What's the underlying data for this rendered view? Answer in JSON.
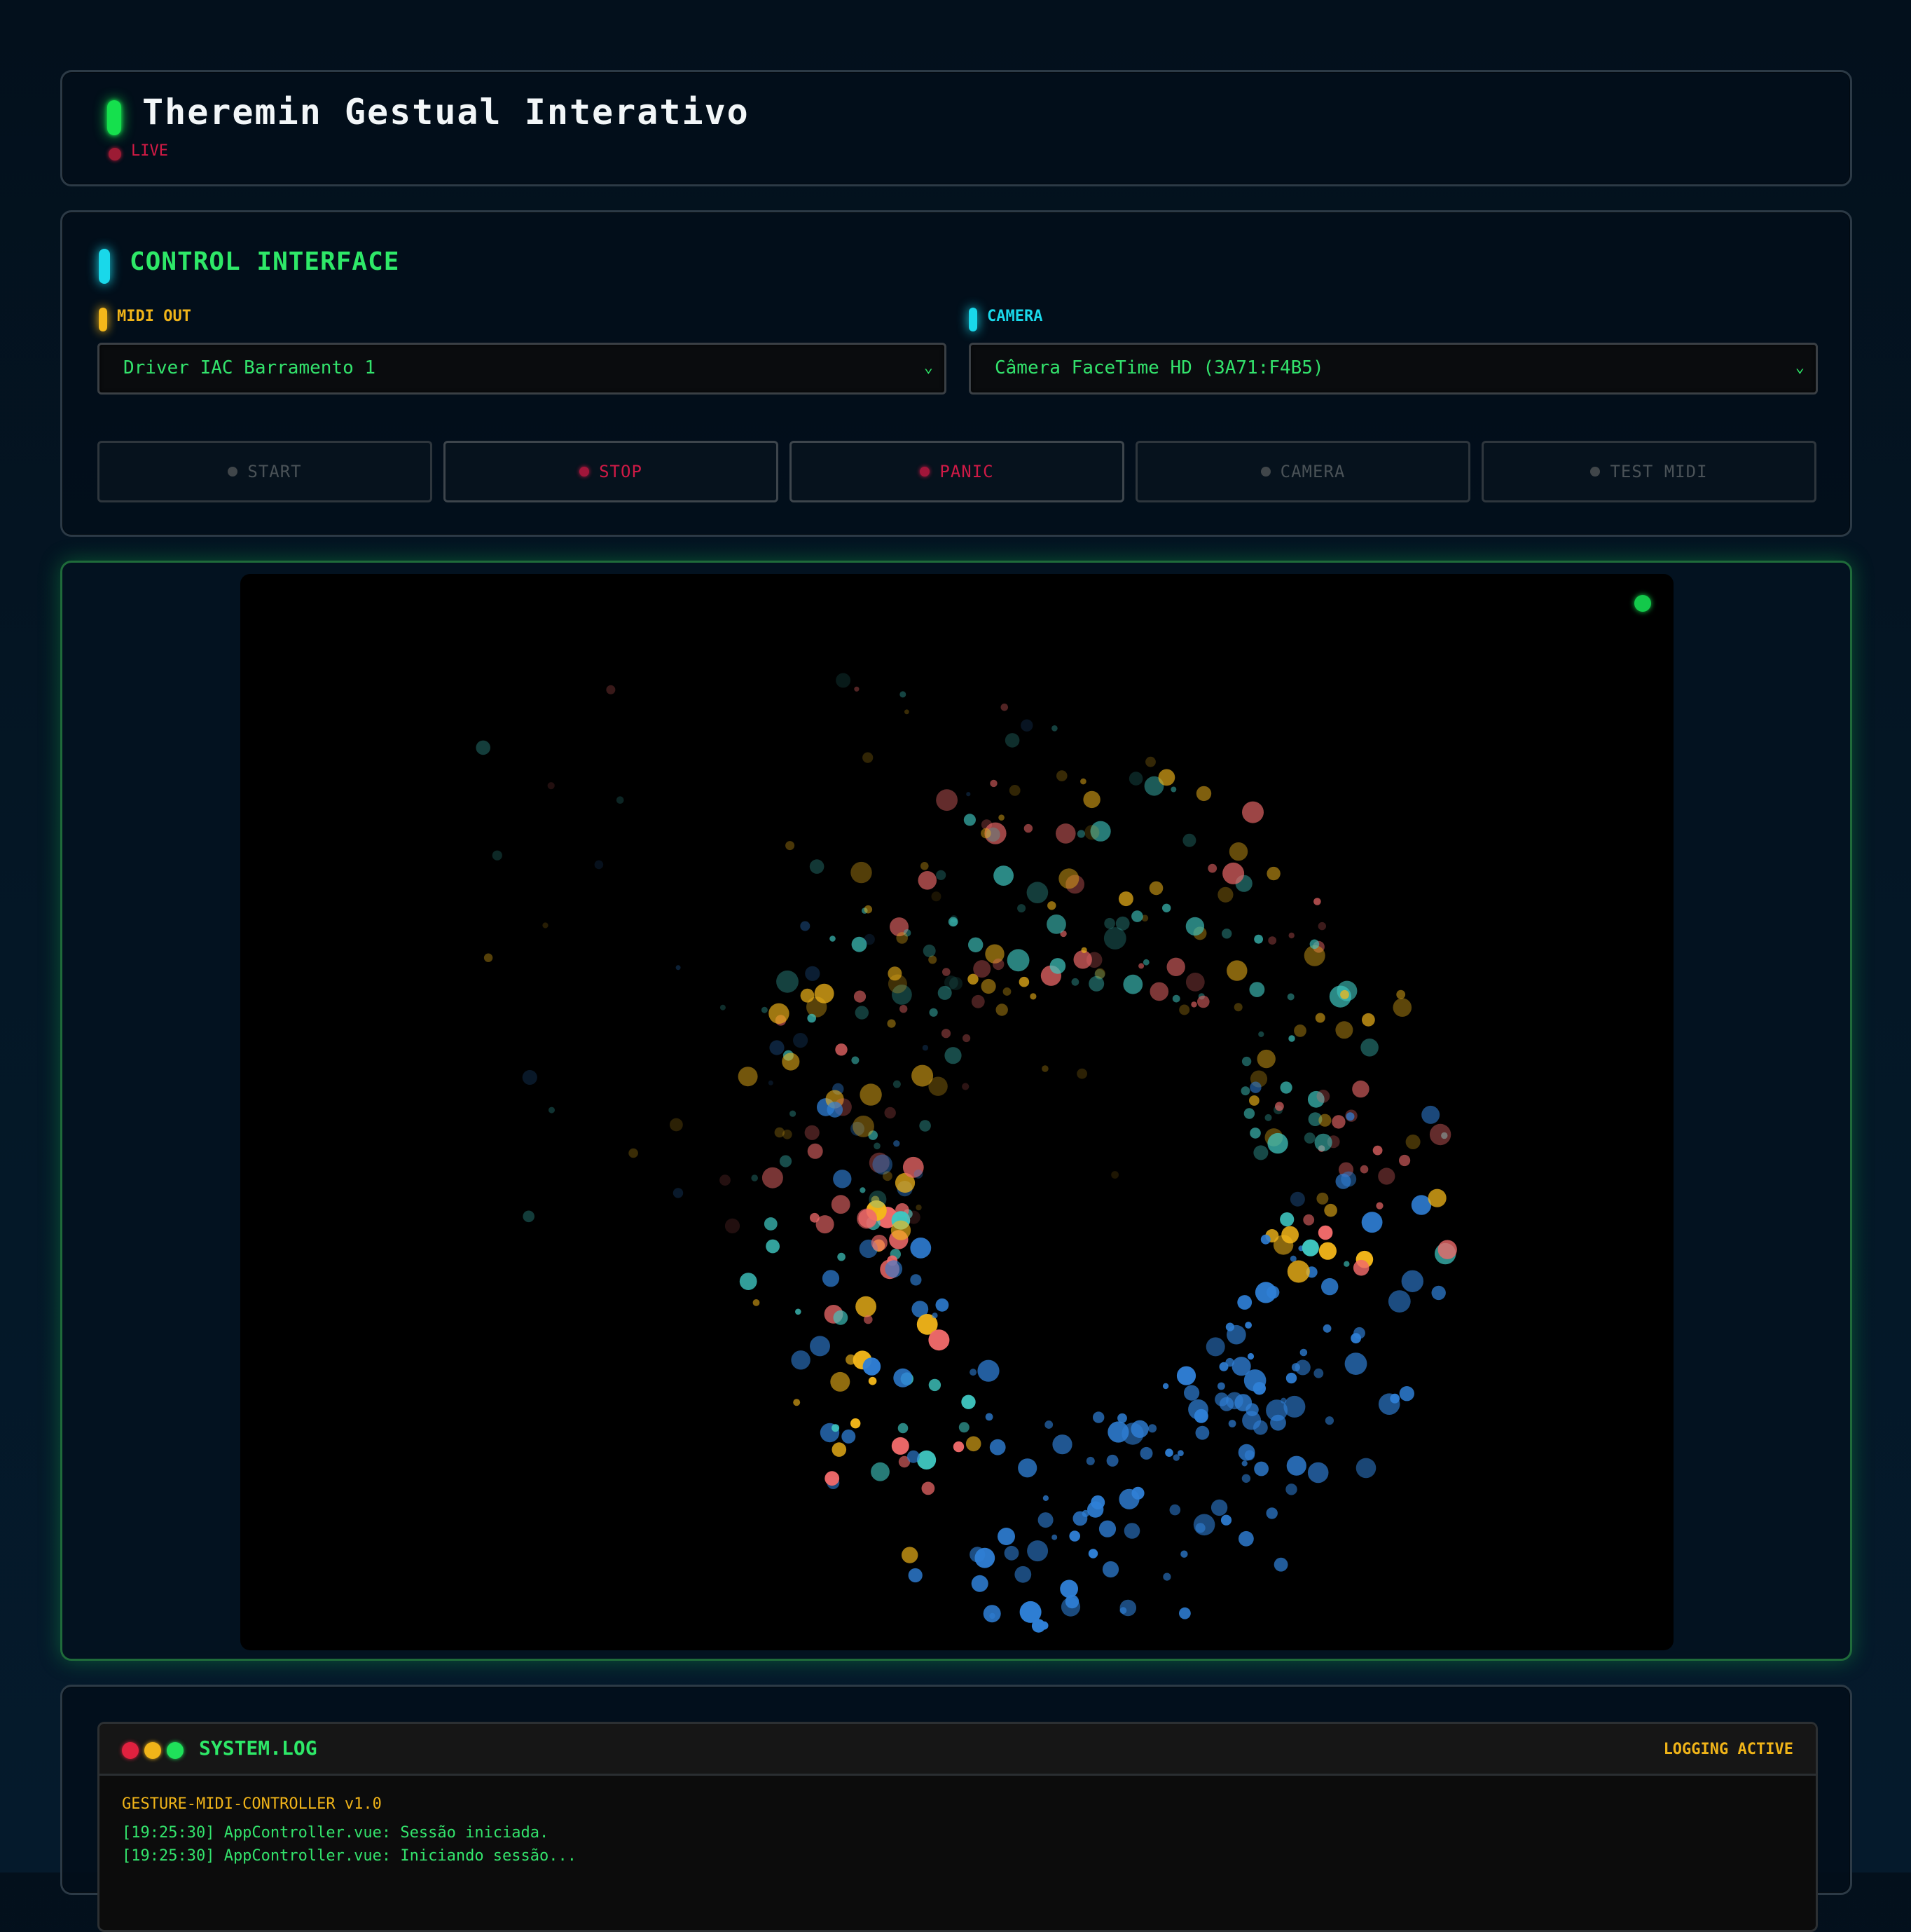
{
  "header": {
    "title": "Theremin Gestual Interativo",
    "status": "LIVE"
  },
  "control": {
    "title": "CONTROL INTERFACE",
    "midi_label": "MIDI OUT",
    "midi_value": "Driver IAC Barramento 1",
    "camera_label": "CAMERA",
    "camera_value": "Câmera FaceTime HD (3A71:F4B5)",
    "buttons": [
      {
        "label": "START",
        "state": "disabled"
      },
      {
        "label": "STOP",
        "state": "active"
      },
      {
        "label": "PANIC",
        "state": "active"
      },
      {
        "label": "CAMERA",
        "state": "disabled"
      },
      {
        "label": "TEST MIDI",
        "state": "disabled"
      }
    ]
  },
  "visualizer": {
    "status_indicator": "on",
    "particle_colors": [
      "#f06a6a",
      "#3fc6c0",
      "#f4b71a",
      "#2f7fd6"
    ]
  },
  "log": {
    "title": "SYSTEM.LOG",
    "status": "LOGGING ACTIVE",
    "header": "GESTURE-MIDI-CONTROLLER v1.0",
    "lines": [
      "[19:25:30] AppController.vue: Sessão iniciada.",
      "[19:25:30] AppController.vue: Iniciando sessão..."
    ]
  },
  "colors": {
    "accent_green": "#15e04d",
    "accent_cyan": "#19d8ea",
    "accent_amber": "#f4b71a",
    "alert_red": "#cf1a46"
  }
}
